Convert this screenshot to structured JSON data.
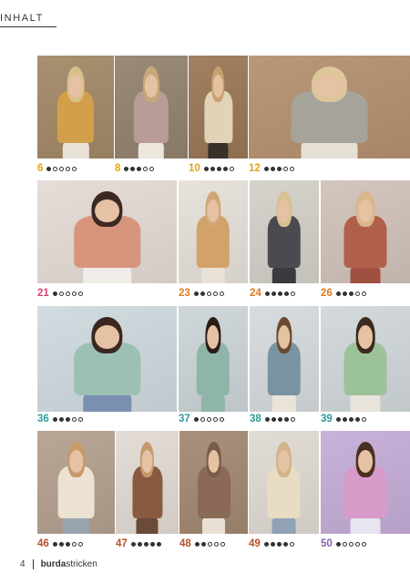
{
  "header": {
    "title": "INHALT"
  },
  "footer": {
    "page_number": "4",
    "brand_bold": "burda",
    "brand_light": "stricken"
  },
  "colors": {
    "yellow": "#e0a317",
    "orange": "#e07a1d",
    "rose": "#d8437a",
    "teal": "#2a9a9b",
    "rust": "#b8512a",
    "violet": "#8b5fa8"
  },
  "rows": [
    {
      "items": [
        {
          "number": "6",
          "difficulty": 1,
          "color": "#e0a317",
          "bg": "#a89070",
          "top": "#d2a04a",
          "hair": "#d8c08a",
          "legs": "#e8e2d6"
        },
        {
          "number": "8",
          "difficulty": 3,
          "color": "#e0a317",
          "bg": "#9a8a78",
          "top": "#b99c96",
          "hair": "#c8a878",
          "legs": "#ece6dc"
        },
        {
          "number": "10",
          "difficulty": 4,
          "color": "#e0a317",
          "bg": "#a08060",
          "top": "#e2d2b8",
          "hair": "#c8a070",
          "legs": "#3a302a"
        },
        {
          "number": "12",
          "difficulty": 3,
          "color": "#e0a317",
          "bg": "#b89878",
          "top": "#a6a39a",
          "hair": "#dcc69a",
          "legs": "#e6e0d4"
        }
      ]
    },
    {
      "items": [
        {
          "number": "21",
          "difficulty": 1,
          "color": "#d8437a",
          "bg": "#e6dcd8",
          "top": "#d6957c",
          "hair": "#3a2a22",
          "legs": "#f0ece8"
        },
        {
          "number": "23",
          "difficulty": 2,
          "color": "#e07a1d",
          "bg": "#e8e2dc",
          "top": "#d2a26a",
          "hair": "#d0a878",
          "legs": "#e8e2d8"
        },
        {
          "number": "24",
          "difficulty": 4,
          "color": "#e07a1d",
          "bg": "#d6d2cc",
          "top": "#4a4a50",
          "hair": "#d8c090",
          "legs": "#3a3a40"
        },
        {
          "number": "26",
          "difficulty": 3,
          "color": "#e07a1d",
          "bg": "#d4c6bc",
          "top": "#b0604a",
          "hair": "#d8b88a",
          "legs": "#a05040"
        }
      ]
    },
    {
      "items": [
        {
          "number": "36",
          "difficulty": 3,
          "color": "#2a9a9b",
          "bg": "#d2dce0",
          "top": "#9cc0b4",
          "hair": "#3a2820",
          "legs": "#7a90b0"
        },
        {
          "number": "37",
          "difficulty": 1,
          "color": "#2a9a9b",
          "bg": "#cfd7da",
          "top": "#8fb5a8",
          "hair": "#2a1c16",
          "legs": "#8fb5a8"
        },
        {
          "number": "38",
          "difficulty": 4,
          "color": "#2a9a9b",
          "bg": "#d8dcde",
          "top": "#7a93a2",
          "hair": "#6a4a30",
          "legs": "#eae4d8"
        },
        {
          "number": "39",
          "difficulty": 4,
          "color": "#2a9a9b",
          "bg": "#d4dadc",
          "top": "#9cc29a",
          "hair": "#3a2a20",
          "legs": "#e8e4dc"
        }
      ]
    },
    {
      "items": [
        {
          "number": "46",
          "difficulty": 3,
          "color": "#b8512a",
          "bg": "#b8a696",
          "top": "#ece2d2",
          "hair": "#c89a6a",
          "legs": "#9aa4b0"
        },
        {
          "number": "47",
          "difficulty": 5,
          "color": "#b8512a",
          "bg": "#e4dcd6",
          "top": "#8a5a40",
          "hair": "#c49a6a",
          "legs": "#6a4a38"
        },
        {
          "number": "48",
          "difficulty": 2,
          "color": "#b8512a",
          "bg": "#a8907a",
          "top": "#8a6a56",
          "hair": "#7a5a48",
          "legs": "#e8e0d4"
        },
        {
          "number": "49",
          "difficulty": 4,
          "color": "#b8512a",
          "bg": "#e2dcd6",
          "top": "#e8dcc4",
          "hair": "#d0b48a",
          "legs": "#8fa2b6"
        },
        {
          "number": "50",
          "difficulty": 1,
          "color": "#8b5fa8",
          "bg": "#c9b2da",
          "top": "#d89ac8",
          "hair": "#4a3020",
          "legs": "#e8e4f0"
        }
      ]
    }
  ]
}
